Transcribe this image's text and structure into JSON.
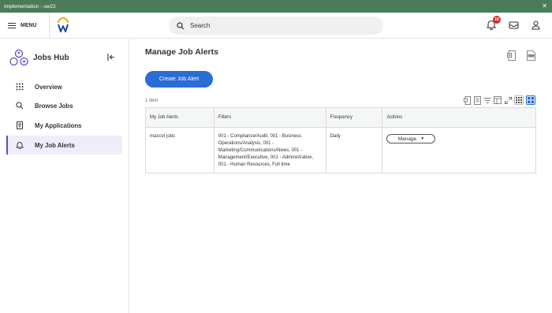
{
  "window": {
    "title": "Implementation - uw22"
  },
  "header": {
    "menu_label": "MENU",
    "search_placeholder": "Search",
    "notification_count": "18"
  },
  "sidebar": {
    "hub_title": "Jobs Hub",
    "items": [
      {
        "label": "Overview",
        "icon": "grid-icon"
      },
      {
        "label": "Browse Jobs",
        "icon": "search-icon"
      },
      {
        "label": "My Applications",
        "icon": "document-icon"
      },
      {
        "label": "My Job Alerts",
        "icon": "bell-icon",
        "active": true
      }
    ]
  },
  "main": {
    "title": "Manage Job Alerts",
    "create_button": "Create Job Alert",
    "item_count": "1 item",
    "table": {
      "headers": [
        "My Job Alerts",
        "Filters",
        "Frequency",
        "Actions"
      ],
      "rows": [
        {
          "name": "mascot jobs",
          "filters": "001 - Compliance/Audit, 001 - Business Operations/Analysis, 001 - Marketing/Communications/News, 001 - Management/Executive, 001 - Administrative, 001 - Human Resources, Full time",
          "frequency": "Daily",
          "action": "Manage"
        }
      ]
    }
  },
  "colors": {
    "title_bar": "#4a7c59",
    "accent": "#2a6dd7",
    "active_nav": "#5a4fc7",
    "badge": "#d32f2f"
  }
}
